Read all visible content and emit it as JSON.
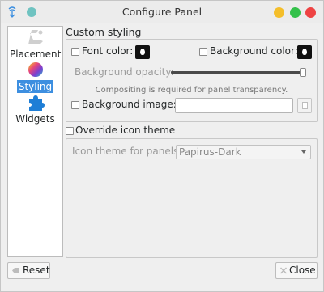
{
  "window": {
    "title": "Configure Panel"
  },
  "sidebar": {
    "items": [
      {
        "label": "Placement",
        "icon": "placement-icon",
        "selected": false
      },
      {
        "label": "Styling",
        "icon": "color-wheel-icon",
        "selected": true
      },
      {
        "label": "Widgets",
        "icon": "puzzle-icon",
        "selected": false
      }
    ]
  },
  "styling": {
    "group_title": "Custom styling",
    "font_color_label": "Font color:",
    "font_color_checked": false,
    "background_color_label": "Background color:",
    "background_color_checked": false,
    "background_opacity_label": "Background opacity:",
    "background_opacity_value": 1.0,
    "transparency_note": "Compositing is required for panel transparency.",
    "background_image_label": "Background image:",
    "background_image_checked": false,
    "background_image_value": ""
  },
  "icon_theme": {
    "override_label": "Override icon theme",
    "override_checked": false,
    "theme_for_panels_label": "Icon theme for panels:",
    "theme_for_panels_value": "Papirus-Dark"
  },
  "buttons": {
    "reset_label": "Reset",
    "close_label": "Close"
  },
  "colors": {
    "selection": "#3d8fe0",
    "minimize": "#f4be2a",
    "maximize": "#33c14a",
    "close": "#ee4343",
    "pin": "#6fc3c1",
    "color_swatch": "#111111"
  }
}
